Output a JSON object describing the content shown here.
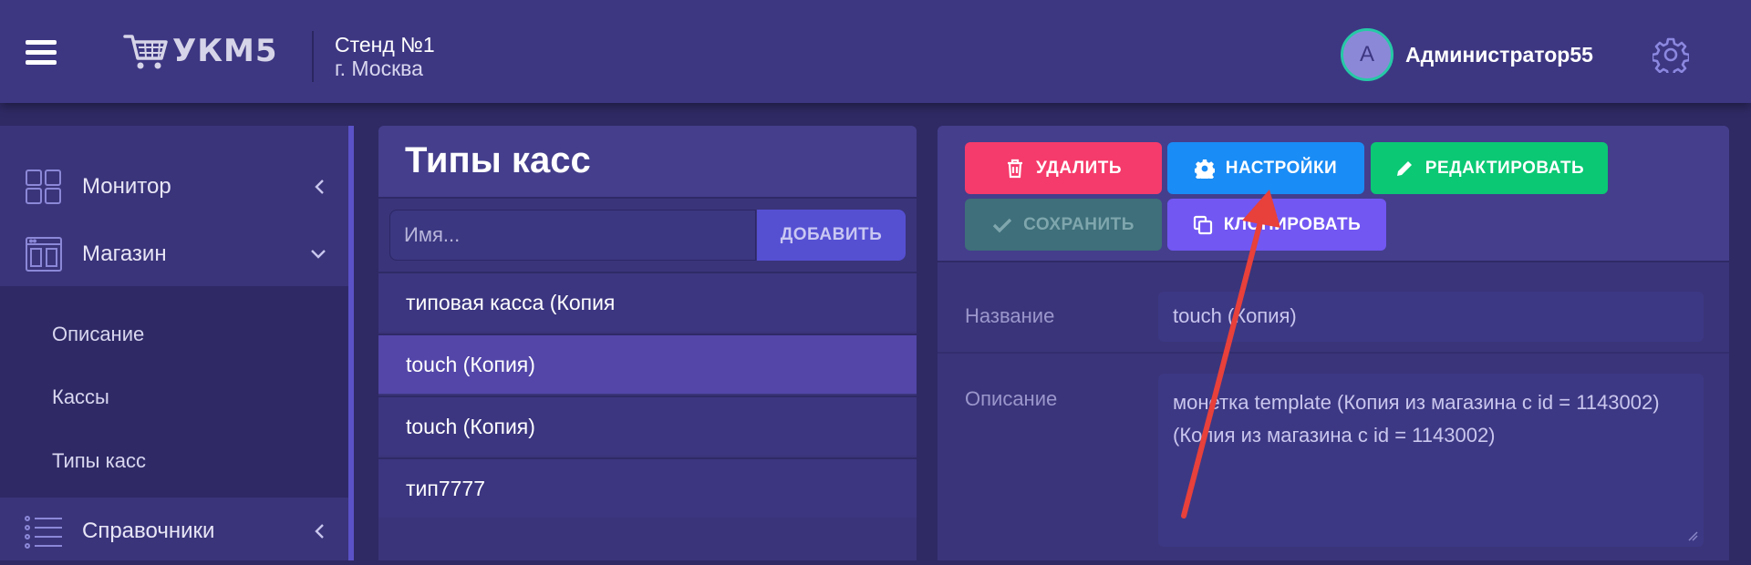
{
  "header": {
    "logo_text": "УКМ5",
    "store_name": "Стенд №1",
    "store_city": "г. Москва",
    "avatar_letter": "А",
    "user_name": "Администратор55"
  },
  "sidebar": {
    "items": [
      {
        "label": "Монитор",
        "icon": "grid-icon",
        "chevron": "chevron-left-icon"
      },
      {
        "label": "Магазин",
        "icon": "store-icon",
        "chevron": "chevron-down-icon"
      },
      {
        "label": "Справочники",
        "icon": "list-icon",
        "chevron": "chevron-left-icon"
      }
    ],
    "sub_items": [
      {
        "label": "Описание"
      },
      {
        "label": "Кассы"
      },
      {
        "label": "Типы касс"
      }
    ]
  },
  "middle": {
    "title": "Типы касс",
    "search_placeholder": "Имя...",
    "add_label": "ДОБАВИТЬ",
    "rows": [
      {
        "label": "типовая касса (Копия",
        "selected": false
      },
      {
        "label": "touch (Копия)",
        "selected": true
      },
      {
        "label": "touch (Копия)",
        "selected": false
      },
      {
        "label": "тип7777",
        "selected": false
      }
    ]
  },
  "right": {
    "buttons": {
      "delete": "УДАЛИТЬ",
      "settings": "НАСТРОЙКИ",
      "edit": "РЕДАКТИРОВАТЬ",
      "save": "СОХРАНИТЬ",
      "clone": "КЛОНИРОВАТЬ"
    },
    "form": {
      "name_label": "Название",
      "name_value": "touch (Копия)",
      "description_label": "Описание",
      "description_value": "монетка template (Копия из магазина с id = 1143002) (Копия из магазина с id = 1143002)"
    }
  },
  "colors": {
    "header_bg": "#3d3782",
    "delete": "#f53b6b",
    "settings": "#1a8cf5",
    "edit": "#0bc874",
    "save_disabled": "#3e6f7a",
    "clone": "#7257f2",
    "selected_row": "#5346a8",
    "annotation_arrow": "#e8403a"
  }
}
